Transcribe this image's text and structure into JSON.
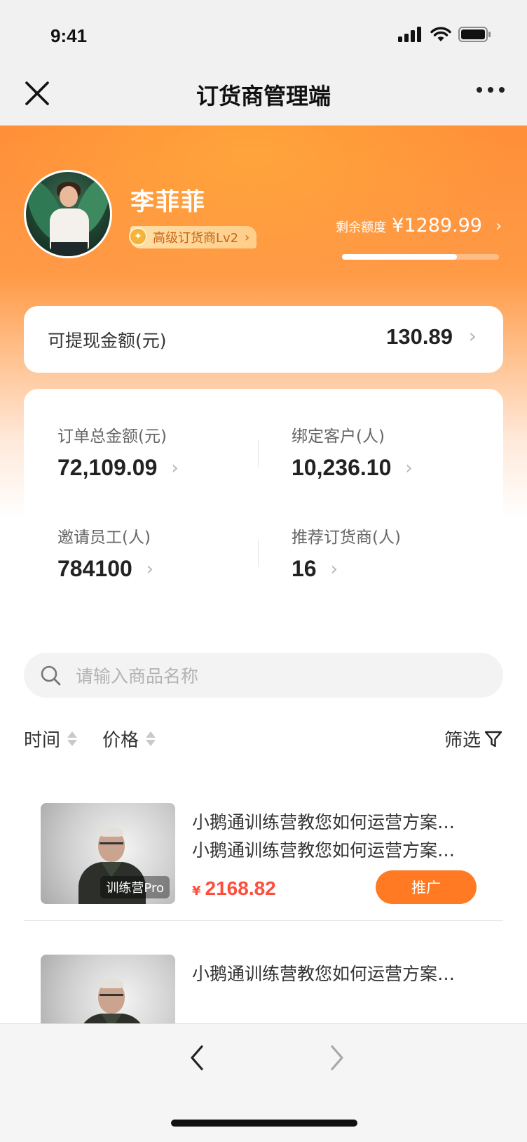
{
  "status": {
    "time": "9:41"
  },
  "nav": {
    "title": "订货商管理端"
  },
  "profile": {
    "name": "李菲菲",
    "badge": "高级订货商Lv2",
    "quota_label": "剩余额度",
    "quota_value": "¥1289.99",
    "quota_progress": 0.73
  },
  "withdraw": {
    "label": "可提现金额(元)",
    "value": "130.89"
  },
  "stats": [
    {
      "label": "订单总金额(元)",
      "value": "72,109.09"
    },
    {
      "label": "绑定客户(人)",
      "value": "10,236.10"
    },
    {
      "label": "邀请员工(人)",
      "value": "784100"
    },
    {
      "label": "推荐订货商(人)",
      "value": "16"
    }
  ],
  "search": {
    "placeholder": "请输入商品名称"
  },
  "sort": {
    "time": "时间",
    "price": "价格",
    "filter": "筛选"
  },
  "products": [
    {
      "title1": "小鹅通训练营教您如何运营方案…",
      "title2": "小鹅通训练营教您如何运营方案…",
      "tag": "训练营Pro",
      "price_symbol": "¥",
      "price": "2168.82",
      "button": "推广"
    },
    {
      "title1": "小鹅通训练营教您如何运营方案…"
    }
  ],
  "colors": {
    "accent": "#ff7a22",
    "price": "#ff4d3d"
  }
}
